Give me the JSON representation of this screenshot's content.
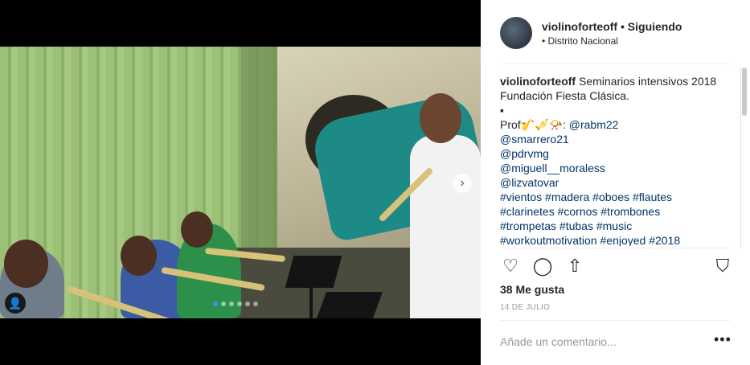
{
  "post": {
    "username": "violinoforteoff",
    "separator": " • ",
    "follow_status": "Siguiendo",
    "location_prefix": "• ",
    "location": "Distrito Nacional"
  },
  "caption": {
    "author": "violinoforteoff",
    "text_line1": " Seminarios intensivos 2018 Fundación Fiesta Clásica.",
    "bullet": "▪",
    "prof_label": "Prof🎷🎺📯: ",
    "mentions": [
      "@rabm22",
      "@smarrero21",
      "@pdrvmg",
      "@miguell__moraless",
      "@lizvatovar"
    ],
    "hashtag_lines": [
      "#vientos #madera #oboes #flautes",
      "#clarinetes #cornos #trombones",
      "#trompetas #tubas #music",
      "#workoutmotivation #enjoyed #2018"
    ]
  },
  "actions": {
    "like_icon": "heart-icon",
    "comment_icon": "comment-icon",
    "share_icon": "share-icon",
    "save_icon": "bookmark-icon",
    "like_glyph": "♡",
    "comment_glyph": "◯",
    "share_glyph": "⇧",
    "save_glyph": "⛉"
  },
  "likes": "38 Me gusta",
  "date": "14 DE JULIO",
  "comment": {
    "placeholder": "Añade un comentario...",
    "value": ""
  },
  "more_glyph": "•••",
  "carousel": {
    "next_glyph": "›",
    "user_tag_glyph": "👤",
    "slide_count": 6,
    "active_slide": 1
  },
  "colors": {
    "accent": "#3897f0",
    "link": "#003569",
    "text": "#262626",
    "muted": "#999999"
  }
}
